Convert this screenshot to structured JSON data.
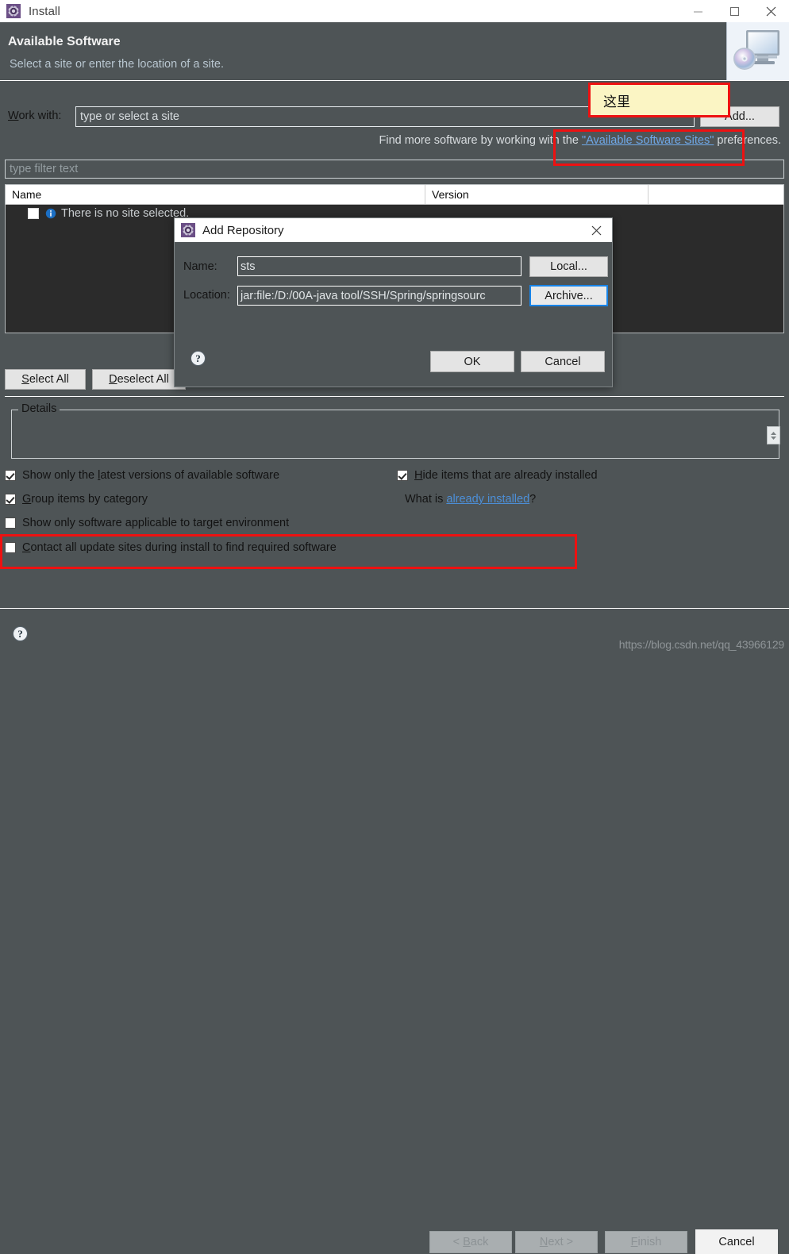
{
  "window": {
    "title": "Install",
    "icon": "eclipse-gear-icon",
    "controls": {
      "minimize": "minimize-icon",
      "maximize": "maximize-icon",
      "close": "close-icon"
    }
  },
  "header": {
    "title": "Available Software",
    "subtitle": "Select a site or enter the location of a site.",
    "banner_icon": "monitor-with-cd-icon"
  },
  "work_with": {
    "label": "Work with:",
    "label_mnemonic": "W",
    "value": "",
    "placeholder": "type or select a site",
    "add_button": "Add...",
    "add_button_mnemonic": "A"
  },
  "find_more": {
    "prefix": "Find more software by working with the ",
    "link": "\"Available Software Sites\"",
    "suffix": " preferences."
  },
  "filter": {
    "placeholder": "type filter text",
    "value": ""
  },
  "tree": {
    "columns": [
      "Name",
      "Version",
      ""
    ],
    "rows": [
      {
        "checked": false,
        "icon": "info-icon",
        "name": "There is no site selected.",
        "version": ""
      }
    ]
  },
  "tree_buttons": {
    "select_all": "Select All",
    "select_all_mnemonic": "S",
    "deselect_all": "Deselect All",
    "deselect_all_mnemonic": "D"
  },
  "details": {
    "legend": "Details",
    "content": "",
    "spinner": "updown-spinner-icon"
  },
  "options": {
    "left": [
      {
        "label": "Show only the latest versions of available software",
        "mnemonic": "l",
        "checked": true
      },
      {
        "label": "Group items by category",
        "mnemonic": "G",
        "checked": true
      },
      {
        "label": "Show only software applicable to target environment",
        "mnemonic": "",
        "checked": false
      },
      {
        "label": "Contact all update sites during install to find required software",
        "mnemonic": "C",
        "checked": false
      }
    ],
    "right": [
      {
        "label": "Hide items that are already installed",
        "mnemonic": "H",
        "checked": true
      }
    ],
    "what_is": {
      "prefix": "What is ",
      "link": "already installed",
      "suffix": "?"
    }
  },
  "footer": {
    "help_icon": "help-question-icon",
    "buttons": [
      {
        "label": "< Back",
        "mnemonic": "B",
        "enabled": false
      },
      {
        "label": "Next >",
        "mnemonic": "N",
        "enabled": false
      },
      {
        "label": "Finish",
        "mnemonic": "F",
        "enabled": false
      },
      {
        "label": "Cancel",
        "mnemonic": "",
        "enabled": true
      }
    ]
  },
  "watermark": "https://blog.csdn.net/qq_43966129",
  "modal": {
    "title": "Add Repository",
    "icon": "eclipse-gear-icon",
    "close": "close-icon",
    "name_label": "Name:",
    "name_value": "sts",
    "location_label": "Location:",
    "location_value": "jar:file:/D:/00A-java tool/SSH/Spring/springsourc",
    "local_button": "Local...",
    "archive_button": "Archive...",
    "ok_button": "OK",
    "cancel_button": "Cancel",
    "help_icon": "help-question-icon"
  },
  "annotations": {
    "note_text": "这里",
    "highlight_color": "#ee1111",
    "note_bg": "#fbf5c4"
  }
}
